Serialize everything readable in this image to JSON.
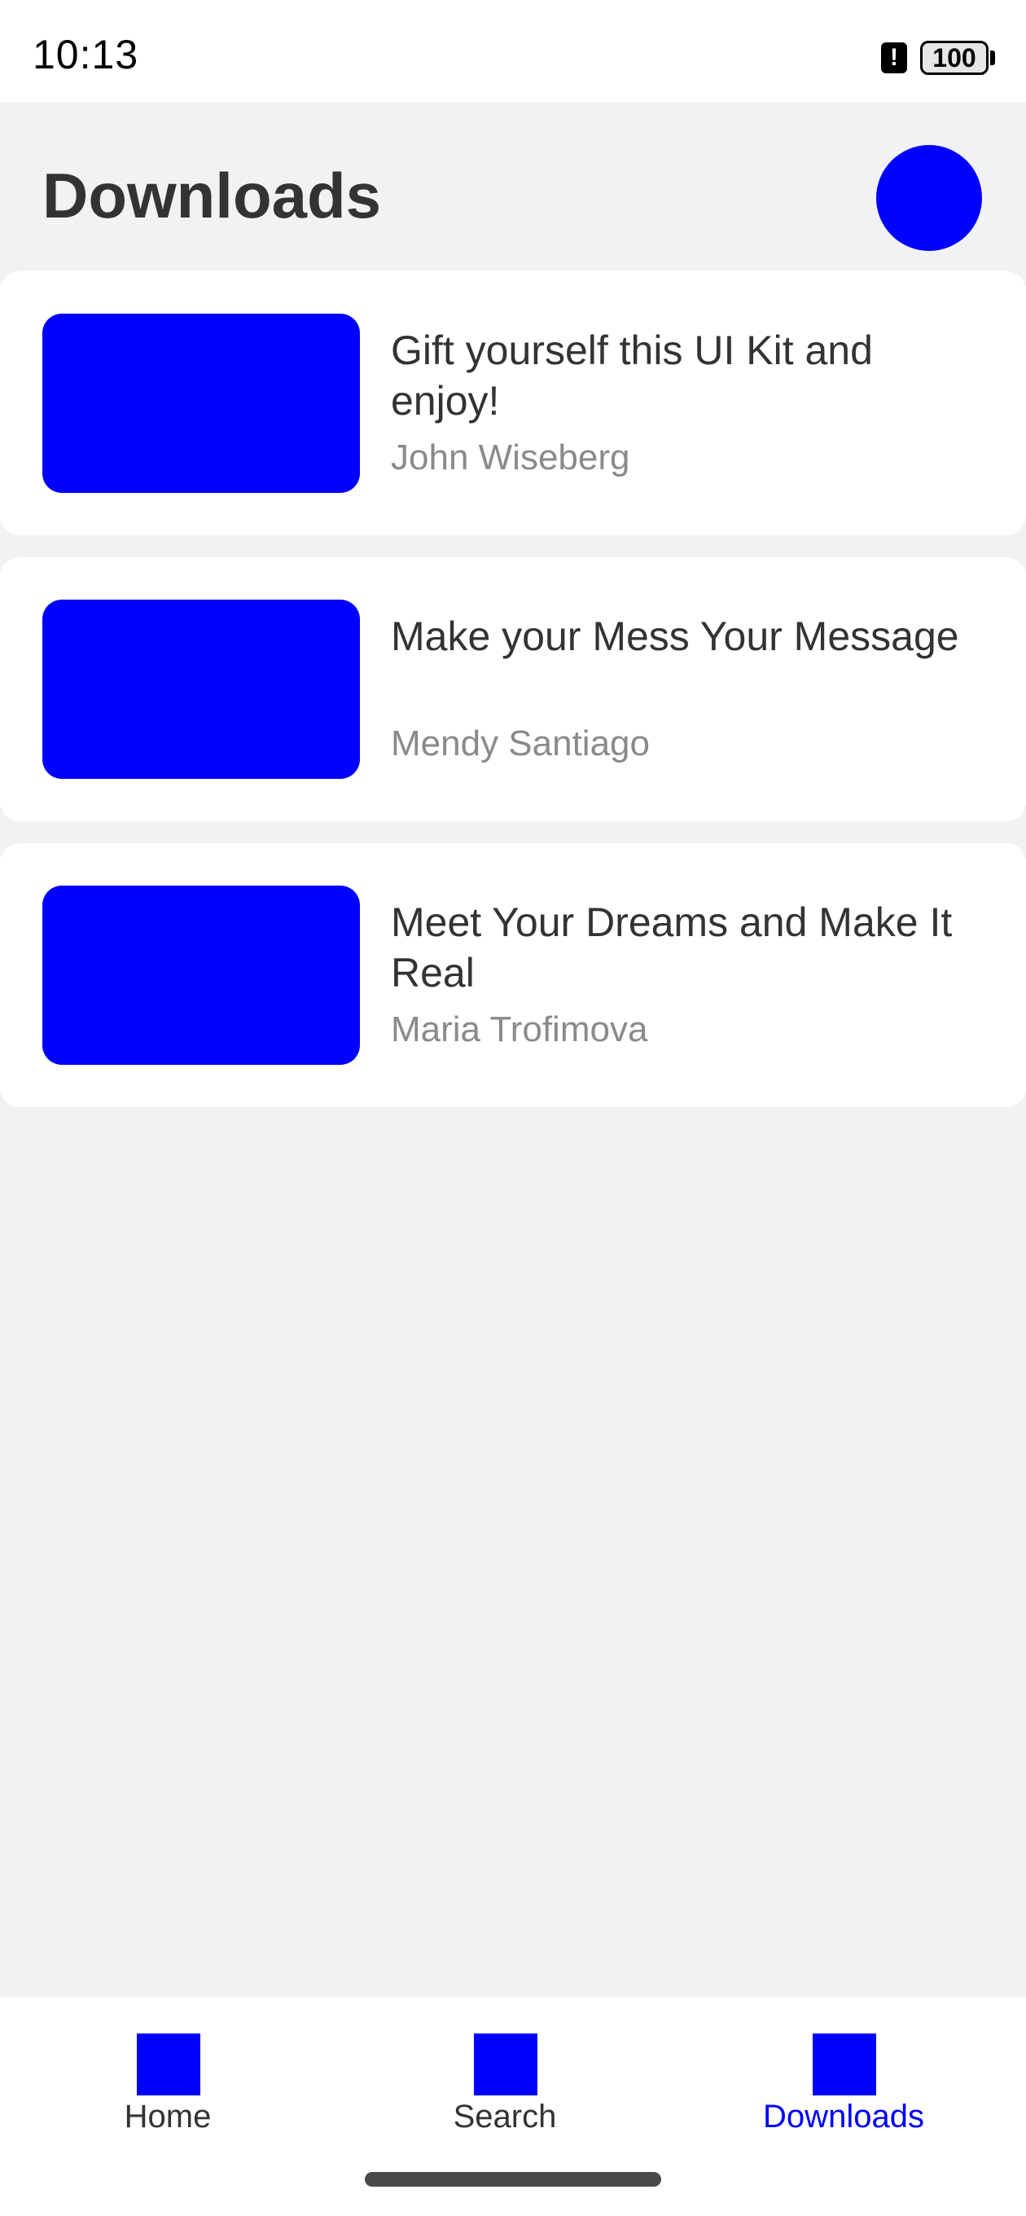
{
  "status_bar": {
    "time": "10:13",
    "alert_icon": "alert-icon",
    "battery": "100"
  },
  "header": {
    "title": "Downloads",
    "avatar_color": "#0000FF"
  },
  "downloads": [
    {
      "title": "Gift yourself this UI Kit and enjoy!",
      "author": "John Wiseberg"
    },
    {
      "title": "Make your Mess Your Message",
      "author": "Mendy Santiago"
    },
    {
      "title": "Meet Your Dreams and Make It Real",
      "author": "Maria Trofimova"
    }
  ],
  "nav": {
    "items": [
      {
        "label": "Home",
        "icon": "home-icon"
      },
      {
        "label": "Search",
        "icon": "search-icon"
      },
      {
        "label": "Downloads",
        "icon": "downloads-icon"
      }
    ],
    "active": "Downloads"
  },
  "colors": {
    "accent": "#0000FF",
    "background": "#F1F2F4",
    "card": "#FFFFFF",
    "text": "#333333",
    "secondary_text": "#8A8A8A"
  }
}
